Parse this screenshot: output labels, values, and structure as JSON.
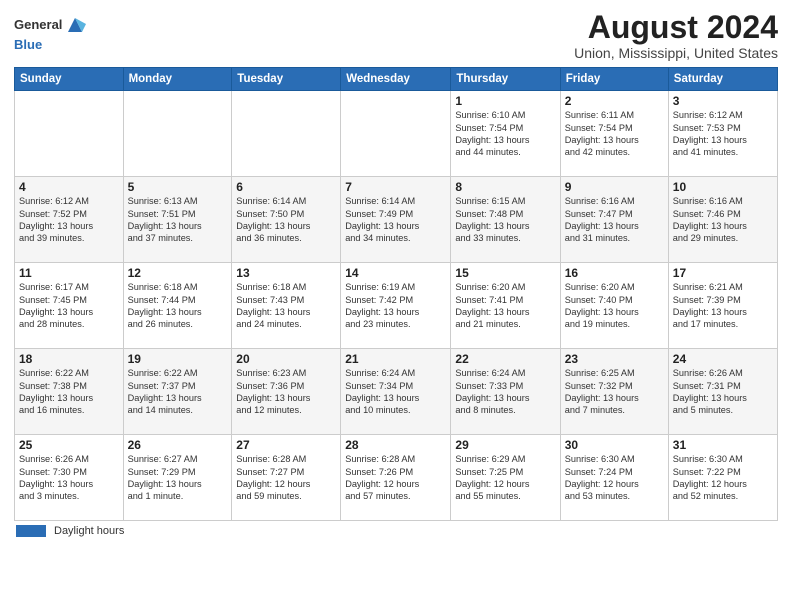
{
  "header": {
    "logo_line1": "General",
    "logo_line2": "Blue",
    "title": "August 2024",
    "subtitle": "Union, Mississippi, United States"
  },
  "calendar": {
    "days_of_week": [
      "Sunday",
      "Monday",
      "Tuesday",
      "Wednesday",
      "Thursday",
      "Friday",
      "Saturday"
    ],
    "weeks": [
      [
        {
          "day": "",
          "info": ""
        },
        {
          "day": "",
          "info": ""
        },
        {
          "day": "",
          "info": ""
        },
        {
          "day": "",
          "info": ""
        },
        {
          "day": "1",
          "info": "Sunrise: 6:10 AM\nSunset: 7:54 PM\nDaylight: 13 hours\nand 44 minutes."
        },
        {
          "day": "2",
          "info": "Sunrise: 6:11 AM\nSunset: 7:54 PM\nDaylight: 13 hours\nand 42 minutes."
        },
        {
          "day": "3",
          "info": "Sunrise: 6:12 AM\nSunset: 7:53 PM\nDaylight: 13 hours\nand 41 minutes."
        }
      ],
      [
        {
          "day": "4",
          "info": "Sunrise: 6:12 AM\nSunset: 7:52 PM\nDaylight: 13 hours\nand 39 minutes."
        },
        {
          "day": "5",
          "info": "Sunrise: 6:13 AM\nSunset: 7:51 PM\nDaylight: 13 hours\nand 37 minutes."
        },
        {
          "day": "6",
          "info": "Sunrise: 6:14 AM\nSunset: 7:50 PM\nDaylight: 13 hours\nand 36 minutes."
        },
        {
          "day": "7",
          "info": "Sunrise: 6:14 AM\nSunset: 7:49 PM\nDaylight: 13 hours\nand 34 minutes."
        },
        {
          "day": "8",
          "info": "Sunrise: 6:15 AM\nSunset: 7:48 PM\nDaylight: 13 hours\nand 33 minutes."
        },
        {
          "day": "9",
          "info": "Sunrise: 6:16 AM\nSunset: 7:47 PM\nDaylight: 13 hours\nand 31 minutes."
        },
        {
          "day": "10",
          "info": "Sunrise: 6:16 AM\nSunset: 7:46 PM\nDaylight: 13 hours\nand 29 minutes."
        }
      ],
      [
        {
          "day": "11",
          "info": "Sunrise: 6:17 AM\nSunset: 7:45 PM\nDaylight: 13 hours\nand 28 minutes."
        },
        {
          "day": "12",
          "info": "Sunrise: 6:18 AM\nSunset: 7:44 PM\nDaylight: 13 hours\nand 26 minutes."
        },
        {
          "day": "13",
          "info": "Sunrise: 6:18 AM\nSunset: 7:43 PM\nDaylight: 13 hours\nand 24 minutes."
        },
        {
          "day": "14",
          "info": "Sunrise: 6:19 AM\nSunset: 7:42 PM\nDaylight: 13 hours\nand 23 minutes."
        },
        {
          "day": "15",
          "info": "Sunrise: 6:20 AM\nSunset: 7:41 PM\nDaylight: 13 hours\nand 21 minutes."
        },
        {
          "day": "16",
          "info": "Sunrise: 6:20 AM\nSunset: 7:40 PM\nDaylight: 13 hours\nand 19 minutes."
        },
        {
          "day": "17",
          "info": "Sunrise: 6:21 AM\nSunset: 7:39 PM\nDaylight: 13 hours\nand 17 minutes."
        }
      ],
      [
        {
          "day": "18",
          "info": "Sunrise: 6:22 AM\nSunset: 7:38 PM\nDaylight: 13 hours\nand 16 minutes."
        },
        {
          "day": "19",
          "info": "Sunrise: 6:22 AM\nSunset: 7:37 PM\nDaylight: 13 hours\nand 14 minutes."
        },
        {
          "day": "20",
          "info": "Sunrise: 6:23 AM\nSunset: 7:36 PM\nDaylight: 13 hours\nand 12 minutes."
        },
        {
          "day": "21",
          "info": "Sunrise: 6:24 AM\nSunset: 7:34 PM\nDaylight: 13 hours\nand 10 minutes."
        },
        {
          "day": "22",
          "info": "Sunrise: 6:24 AM\nSunset: 7:33 PM\nDaylight: 13 hours\nand 8 minutes."
        },
        {
          "day": "23",
          "info": "Sunrise: 6:25 AM\nSunset: 7:32 PM\nDaylight: 13 hours\nand 7 minutes."
        },
        {
          "day": "24",
          "info": "Sunrise: 6:26 AM\nSunset: 7:31 PM\nDaylight: 13 hours\nand 5 minutes."
        }
      ],
      [
        {
          "day": "25",
          "info": "Sunrise: 6:26 AM\nSunset: 7:30 PM\nDaylight: 13 hours\nand 3 minutes."
        },
        {
          "day": "26",
          "info": "Sunrise: 6:27 AM\nSunset: 7:29 PM\nDaylight: 13 hours\nand 1 minute."
        },
        {
          "day": "27",
          "info": "Sunrise: 6:28 AM\nSunset: 7:27 PM\nDaylight: 12 hours\nand 59 minutes."
        },
        {
          "day": "28",
          "info": "Sunrise: 6:28 AM\nSunset: 7:26 PM\nDaylight: 12 hours\nand 57 minutes."
        },
        {
          "day": "29",
          "info": "Sunrise: 6:29 AM\nSunset: 7:25 PM\nDaylight: 12 hours\nand 55 minutes."
        },
        {
          "day": "30",
          "info": "Sunrise: 6:30 AM\nSunset: 7:24 PM\nDaylight: 12 hours\nand 53 minutes."
        },
        {
          "day": "31",
          "info": "Sunrise: 6:30 AM\nSunset: 7:22 PM\nDaylight: 12 hours\nand 52 minutes."
        }
      ]
    ]
  },
  "footer": {
    "daylight_label": "Daylight hours"
  }
}
